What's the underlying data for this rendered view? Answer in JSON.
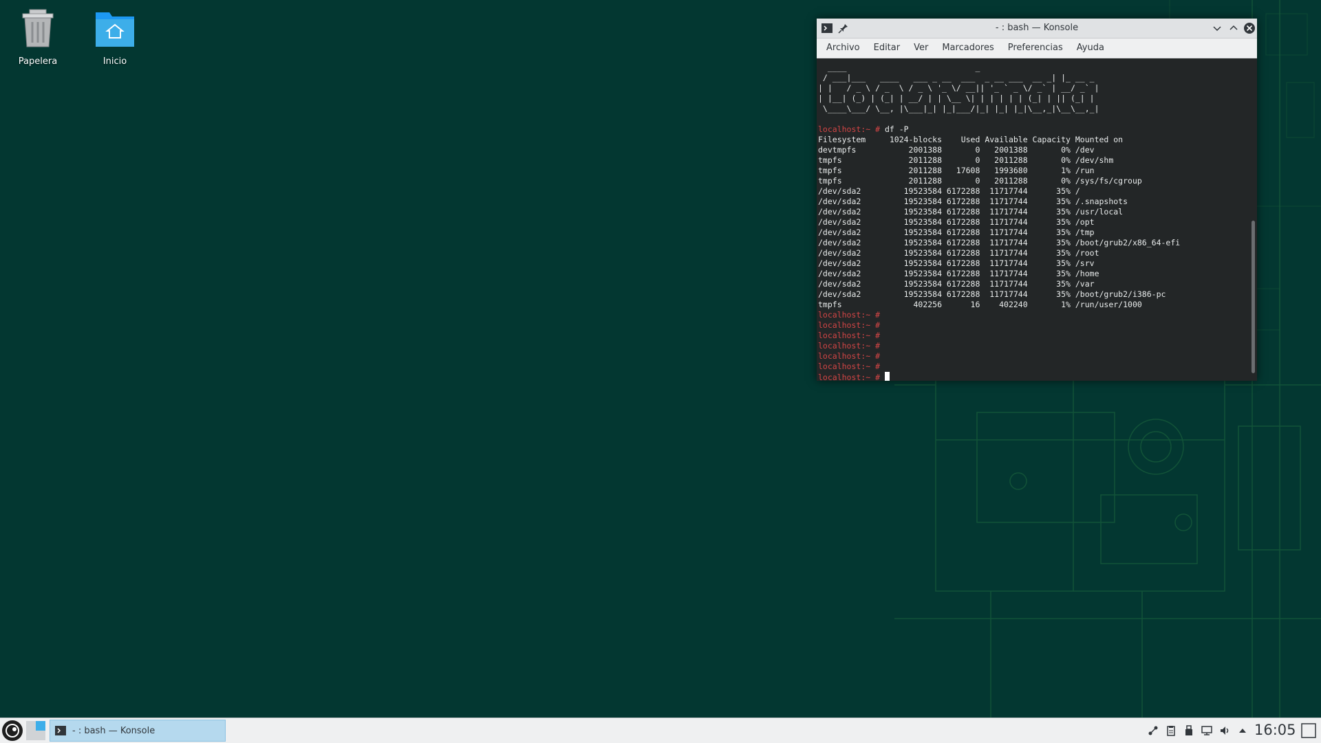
{
  "desktop": {
    "icons": [
      {
        "label": "Papelera",
        "icon": "trash-icon"
      },
      {
        "label": "Inicio",
        "icon": "home-folder-icon"
      }
    ]
  },
  "window": {
    "title": "- : bash — Konsole",
    "menu": [
      "Archivo",
      "Editar",
      "Ver",
      "Marcadores",
      "Preferencias",
      "Ayuda"
    ],
    "terminal": {
      "banner": [
        "  ____                           _",
        " / ___|___   ____   ___ _ __  ___  _ __ ___  __ _| |_ __ _",
        "| |   / _ \\ / _  \\ / _ \\ '_ \\/ __|| '_ ` _ \\/ _` | __/ _` |",
        "| |__| (_) | (_| | __/ | | \\__ \\| | | | | | (_| | || (_| |",
        " \\____\\___/ \\__, |\\___|_| |_|___/|_| |_| |_|\\__,_|\\__\\__,_|"
      ],
      "prompt": "localhost:~ #",
      "command": "df -P",
      "header": "Filesystem     1024-blocks    Used Available Capacity Mounted on",
      "rows": [
        "devtmpfs           2001388       0   2001388       0% /dev",
        "tmpfs              2011288       0   2011288       0% /dev/shm",
        "tmpfs              2011288   17608   1993680       1% /run",
        "tmpfs              2011288       0   2011288       0% /sys/fs/cgroup",
        "/dev/sda2         19523584 6172288  11717744      35% /",
        "/dev/sda2         19523584 6172288  11717744      35% /.snapshots",
        "/dev/sda2         19523584 6172288  11717744      35% /usr/local",
        "/dev/sda2         19523584 6172288  11717744      35% /opt",
        "/dev/sda2         19523584 6172288  11717744      35% /tmp",
        "/dev/sda2         19523584 6172288  11717744      35% /boot/grub2/x86_64-efi",
        "/dev/sda2         19523584 6172288  11717744      35% /root",
        "/dev/sda2         19523584 6172288  11717744      35% /srv",
        "/dev/sda2         19523584 6172288  11717744      35% /home",
        "/dev/sda2         19523584 6172288  11717744      35% /var",
        "/dev/sda2         19523584 6172288  11717744      35% /boot/grub2/i386-pc",
        "tmpfs               402256      16    402240       1% /run/user/1000"
      ],
      "empty_prompts": 6
    }
  },
  "taskbar": {
    "task_label": "- : bash — Konsole",
    "clock": "16:05"
  },
  "colors": {
    "desktop_bg": "#033731",
    "terminal_bg": "#232627",
    "prompt_red": "#d34545",
    "task_highlight": "#b5d9ee"
  }
}
